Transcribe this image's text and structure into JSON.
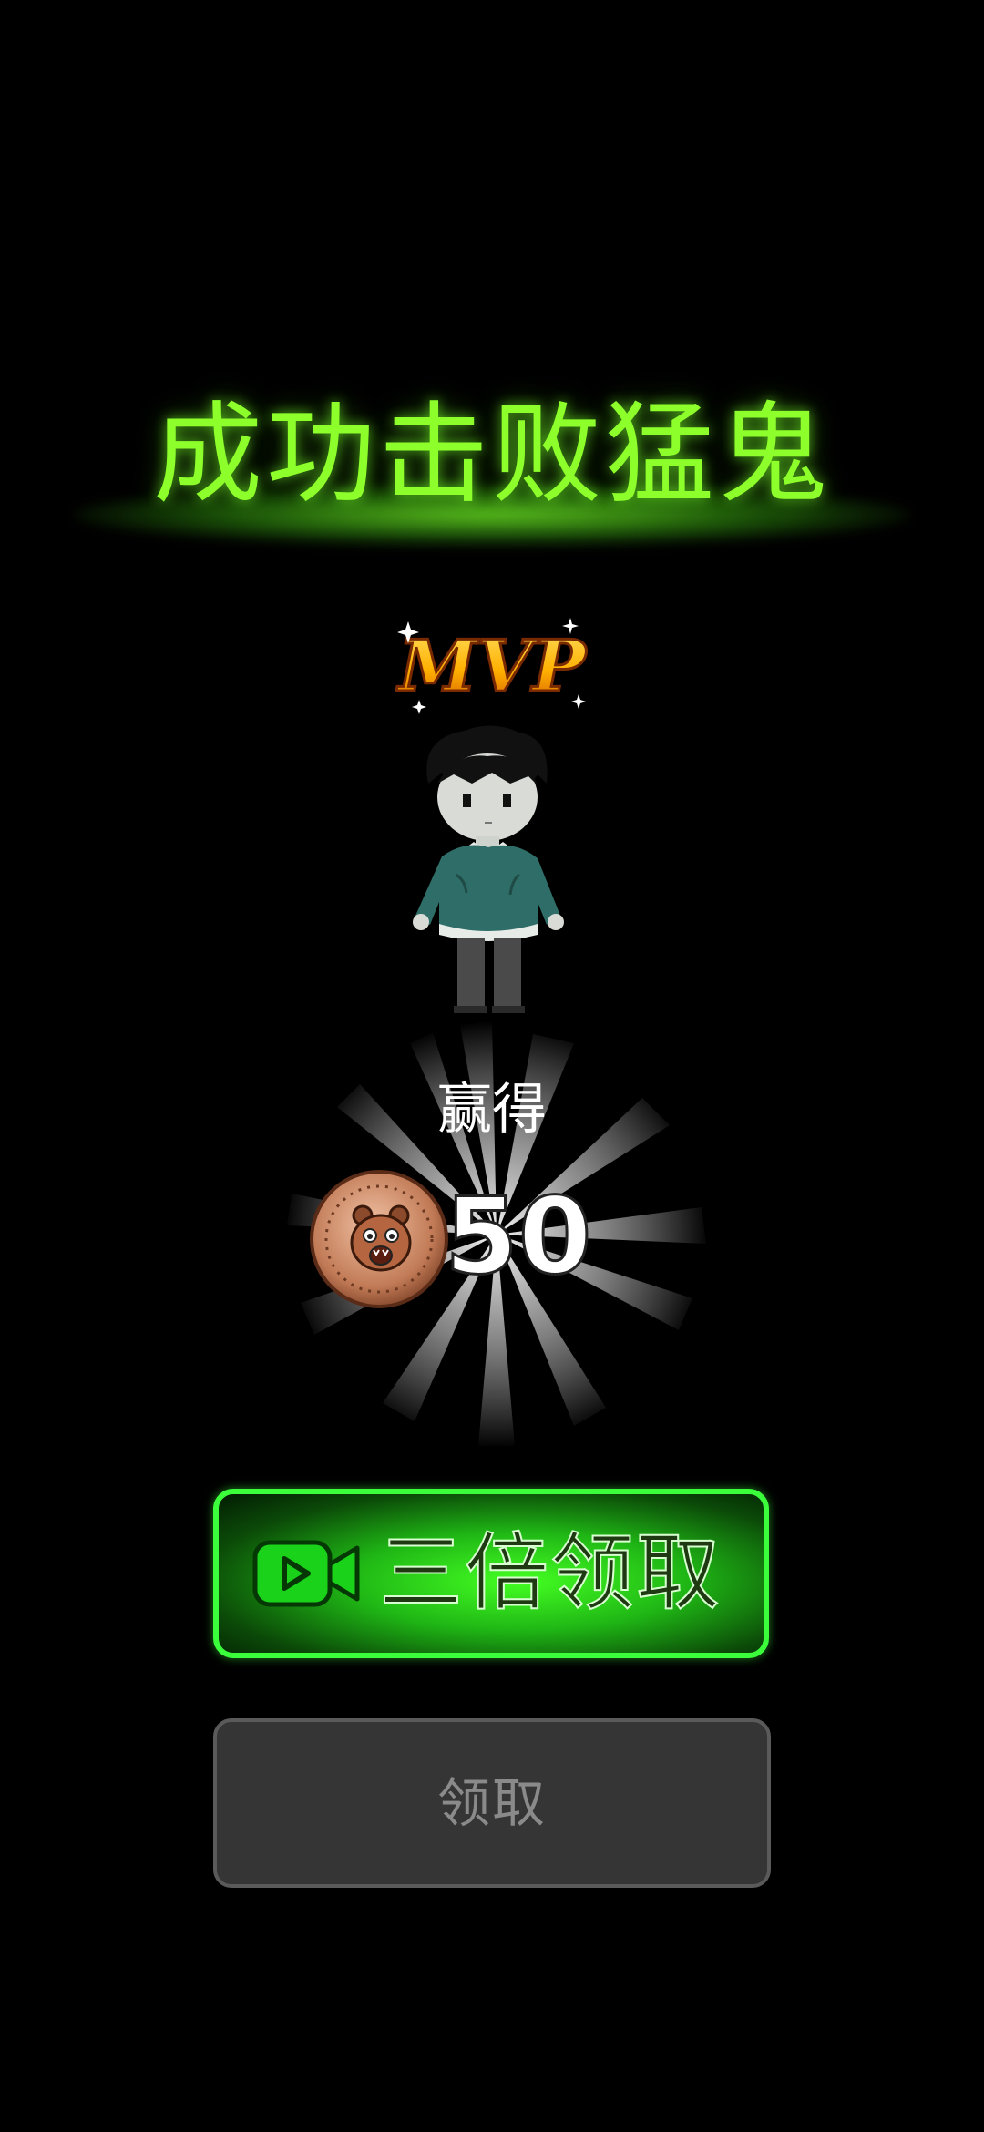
{
  "title": "成功击败猛鬼",
  "badge": {
    "text": "MVP"
  },
  "reward": {
    "label": "赢得",
    "amount": "50",
    "currency_icon": "bear-coin-icon"
  },
  "buttons": {
    "triple_claim": {
      "label": "三倍领取",
      "icon": "video-icon"
    },
    "claim": {
      "label": "领取"
    }
  },
  "colors": {
    "title_green": "#8dff2b",
    "button_green": "#3cff3c",
    "disabled_gray": "#353535"
  }
}
